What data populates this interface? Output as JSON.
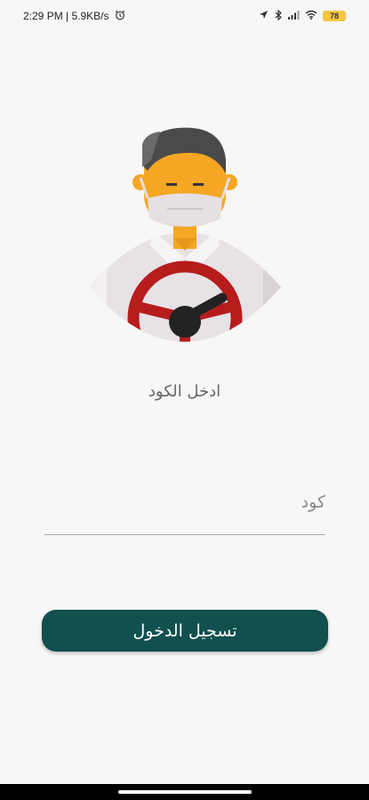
{
  "status_bar": {
    "time_and_speed": "2:29 PM | 5.9KB/s",
    "alarm_icon": "alarm-icon",
    "battery_level": "78",
    "icons": [
      "location-icon",
      "bluetooth-icon",
      "signal-icon",
      "wifi-icon",
      "battery-icon"
    ]
  },
  "illustration": {
    "icon": "driver-with-steering-wheel-illustration"
  },
  "prompt": {
    "text": "ادخل الكود"
  },
  "code_field": {
    "placeholder": "كود",
    "value": ""
  },
  "login_button": {
    "label": "تسجيل الدخول"
  },
  "colors": {
    "primary": "#124f4f",
    "background": "#f7f7f7",
    "skin": "#f5a623",
    "wheel": "#b71c1c"
  }
}
